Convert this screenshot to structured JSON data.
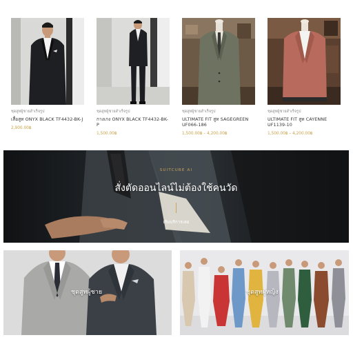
{
  "products": [
    {
      "category": "ชุดสูทผู้ชายสำเร็จรูป",
      "name": "เสื้อสูท ONYX BLACK TF4432-BK-J",
      "price": "2,900.00฿"
    },
    {
      "category": "ชุดสูทผู้ชายสำเร็จรูป",
      "name": "กางเกง ONYX BLACK TF4432-BK-P",
      "price": "1,500.00฿"
    },
    {
      "category": "ชุดสูทผู้ชายสำเร็จรูป",
      "name": "ULTIMATE FIT สูท SAGEGREEN UF066-186",
      "price": "1,500.00฿ – 4,200.00฿"
    },
    {
      "category": "ชุดสูทผู้ชายสำเร็จรูป",
      "name": "ULTIMATE FIT สูท CAYENNE UF1139-10",
      "price": "1,500.00฿ – 4,200.00฿"
    }
  ],
  "banner": {
    "kicker": "SUITCUBE AI",
    "headline": "สั่งตัดออนไลน์ไม่ต้องใช้คนวัด",
    "cta": "เริ่มบริการเลย"
  },
  "tiles": {
    "men": "ชุดสูทผู้ชาย",
    "women": "ชุดสูทผู้หญิง"
  },
  "colors": {
    "accent_gold": "#c9a55a",
    "price_gold": "#c8a248"
  }
}
